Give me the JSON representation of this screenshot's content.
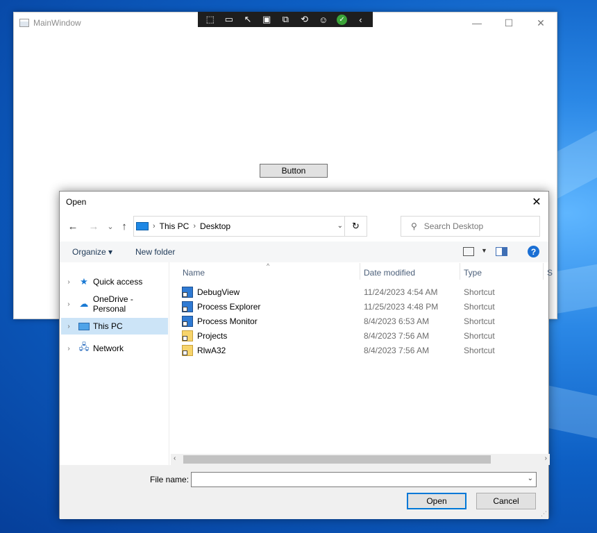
{
  "main_window": {
    "title": "MainWindow",
    "button_label": "Button",
    "controls": [
      "—",
      "☐",
      "✕"
    ]
  },
  "debug_toolbar": {
    "icons": [
      "select-element-icon",
      "video-icon",
      "pointer-icon",
      "frame-icon",
      "track-focus-icon",
      "hot-reload-icon",
      "accessibility-icon",
      "check-icon",
      "collapse-icon"
    ]
  },
  "dialog": {
    "title": "Open",
    "close": "✕",
    "nav": {
      "back": "←",
      "forward": "→",
      "recent": "⌄",
      "up": "↑"
    },
    "breadcrumb": [
      "This PC",
      "Desktop"
    ],
    "search_placeholder": "Search Desktop",
    "toolbar": {
      "organize": "Organize ▾",
      "new_folder": "New folder",
      "help": "?"
    },
    "sidebar": [
      {
        "label": "Quick access",
        "icon": "star-icon"
      },
      {
        "label": "OneDrive - Personal",
        "icon": "cloud-icon"
      },
      {
        "label": "This PC",
        "icon": "computer-icon",
        "selected": true
      },
      {
        "label": "Network",
        "icon": "network-icon"
      }
    ],
    "columns": [
      "Name",
      "Date modified",
      "Type",
      "S"
    ],
    "files": [
      {
        "name": "DebugView",
        "date": "11/24/2023 4:54 AM",
        "type": "Shortcut",
        "icon": "app"
      },
      {
        "name": "Process Explorer",
        "date": "11/25/2023 4:48 PM",
        "type": "Shortcut",
        "icon": "app"
      },
      {
        "name": "Process Monitor",
        "date": "8/4/2023 6:53 AM",
        "type": "Shortcut",
        "icon": "app"
      },
      {
        "name": "Projects",
        "date": "8/4/2023 7:56 AM",
        "type": "Shortcut",
        "icon": "folder"
      },
      {
        "name": "RlwA32",
        "date": "8/4/2023 7:56 AM",
        "type": "Shortcut",
        "icon": "folder"
      }
    ],
    "file_name_label": "File name:",
    "file_name_value": "",
    "open_button": "Open",
    "cancel_button": "Cancel"
  }
}
